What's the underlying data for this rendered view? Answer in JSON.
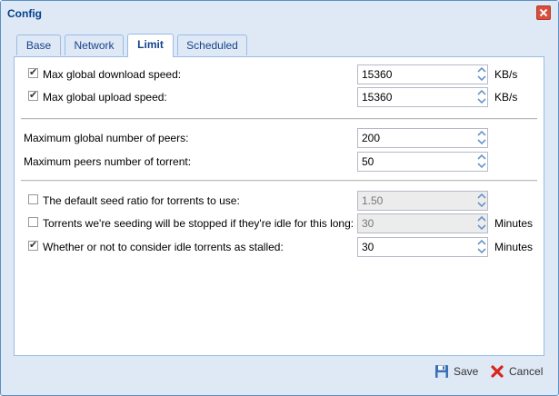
{
  "window": {
    "title": "Config"
  },
  "tabs": [
    {
      "label": "Base"
    },
    {
      "label": "Network"
    },
    {
      "label": "Limit",
      "active": true
    },
    {
      "label": "Scheduled"
    }
  ],
  "limit": {
    "download": {
      "checked": true,
      "label": "Max global download speed:",
      "value": "15360",
      "unit": "KB/s"
    },
    "upload": {
      "checked": true,
      "label": "Max global upload speed:",
      "value": "15360",
      "unit": "KB/s"
    },
    "peers": {
      "label": "Maximum global number of peers:",
      "value": "200"
    },
    "peers_torrent": {
      "label": "Maximum peers number of torrent:",
      "value": "50"
    },
    "seed_ratio": {
      "checked": false,
      "label": "The default seed ratio for torrents to use:",
      "value": "1.50",
      "disabled": true
    },
    "idle_stop": {
      "checked": false,
      "label": "Torrents we're seeding will be stopped if they're idle for this long:",
      "value": "30",
      "unit": "Minutes",
      "disabled": true
    },
    "idle_stalled": {
      "checked": true,
      "label": "Whether or not to consider idle torrents as stalled:",
      "value": "30",
      "unit": "Minutes"
    }
  },
  "footer": {
    "save_label": "Save",
    "cancel_label": "Cancel"
  },
  "colors": {
    "title": "#04408c",
    "border": "#99bbe8",
    "accent": "#5b8fc7",
    "close": "#d94e3d"
  }
}
